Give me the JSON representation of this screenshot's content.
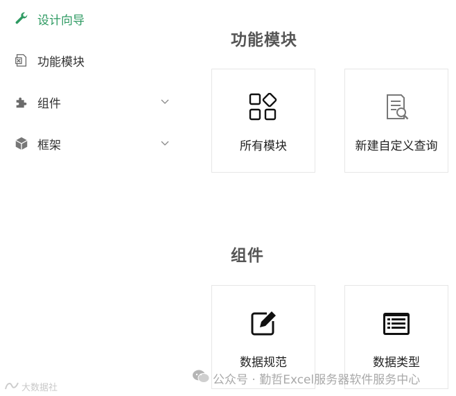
{
  "sidebar": {
    "items": [
      {
        "label": "设计向导",
        "icon": "wrench-icon",
        "active": true
      },
      {
        "label": "功能模块",
        "icon": "excel-file-icon",
        "active": false
      },
      {
        "label": "组件",
        "icon": "puzzle-icon",
        "active": false,
        "expandable": true
      },
      {
        "label": "框架",
        "icon": "cube-icon",
        "active": false,
        "expandable": true
      }
    ]
  },
  "sections": [
    {
      "title": "功能模块",
      "cards": [
        {
          "label": "所有模块",
          "icon": "modules-grid-icon"
        },
        {
          "label": "新建自定义查询",
          "icon": "document-search-icon"
        }
      ]
    },
    {
      "title": "组件",
      "cards": [
        {
          "label": "数据规范",
          "icon": "edit-pencil-icon"
        },
        {
          "label": "数据类型",
          "icon": "list-table-icon"
        }
      ]
    }
  ],
  "watermark": {
    "left_text": "大数据社",
    "right_text": "公众号 · 勤哲Excel服务器软件服务中心"
  },
  "colors": {
    "accent": "#2e9a62",
    "text": "#333333",
    "section_title": "#555555",
    "card_border": "#e6e6e6"
  }
}
